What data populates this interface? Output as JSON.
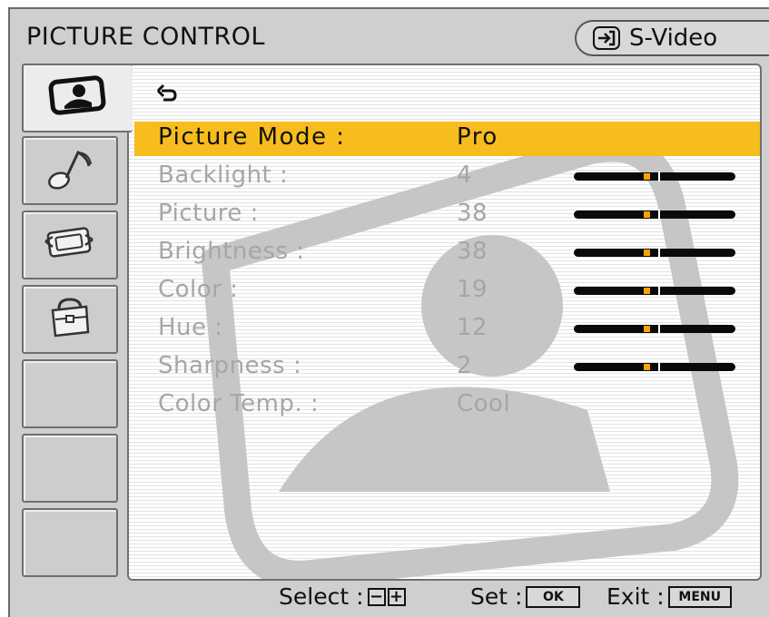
{
  "header": {
    "title": "PICTURE CONTROL",
    "input_source": "S-Video",
    "input_icon": "input-source-icon"
  },
  "tabs": [
    {
      "name": "picture-tab",
      "icon": "picture-icon",
      "active": true
    },
    {
      "name": "sound-tab",
      "icon": "music-note-icon",
      "active": false
    },
    {
      "name": "screen-tab",
      "icon": "screen-adjust-icon",
      "active": false
    },
    {
      "name": "setup-tab",
      "icon": "toolbox-icon",
      "active": false
    },
    {
      "name": "empty-tab-1",
      "icon": "",
      "active": false
    },
    {
      "name": "empty-tab-2",
      "icon": "",
      "active": false
    },
    {
      "name": "empty-tab-3",
      "icon": "",
      "active": false
    }
  ],
  "menu": {
    "back_icon": "return-arrow-icon",
    "items": [
      {
        "label": "Picture Mode :",
        "value": "Pro",
        "selected": true,
        "slider": null
      },
      {
        "label": "Backlight :",
        "value": "4",
        "selected": false,
        "slider": 0.5
      },
      {
        "label": "Picture :",
        "value": "38",
        "selected": false,
        "slider": 0.5
      },
      {
        "label": "Brightness :",
        "value": "38",
        "selected": false,
        "slider": 0.5
      },
      {
        "label": "Color :",
        "value": "19",
        "selected": false,
        "slider": 0.5
      },
      {
        "label": "Hue :",
        "value": "12",
        "selected": false,
        "slider": 0.5
      },
      {
        "label": "Sharpness :",
        "value": "2",
        "selected": false,
        "slider": 0.5
      },
      {
        "label": "Color Temp. :",
        "value": "Cool",
        "selected": false,
        "slider": null
      }
    ]
  },
  "footer": {
    "select_label": "Select :",
    "select_keys": [
      "−",
      "+"
    ],
    "set_label": "Set :",
    "set_key": "OK",
    "exit_label": "Exit :",
    "exit_key": "MENU"
  },
  "colors": {
    "highlight": "#f7bd1e",
    "slider_marker": "#f7a400",
    "disabled_text": "#a6a6a6"
  }
}
